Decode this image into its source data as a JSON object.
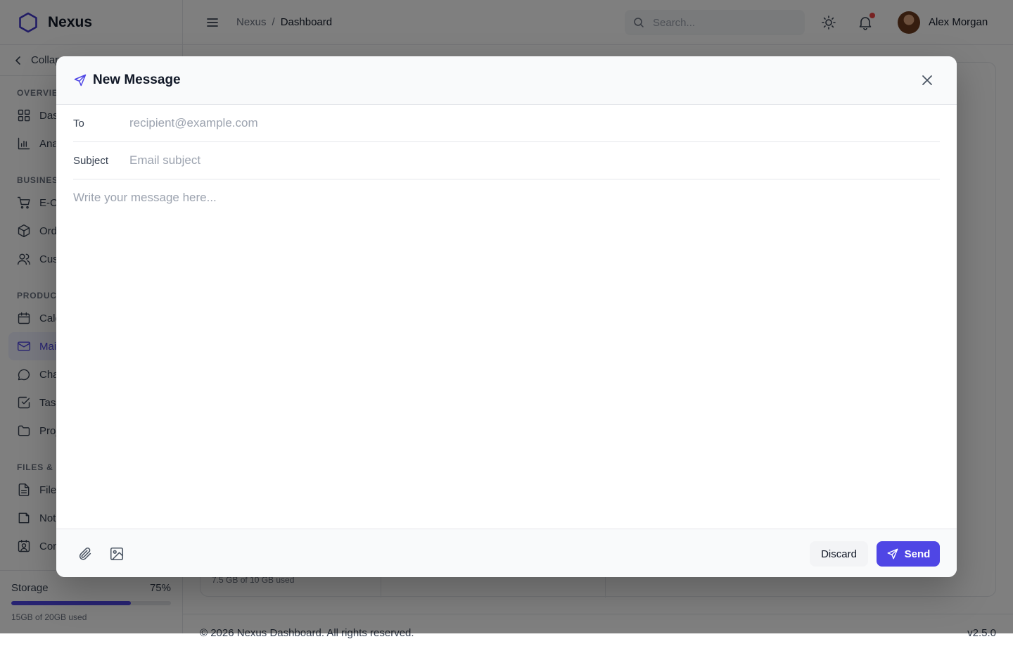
{
  "app": {
    "brand": "Nexus",
    "collapse_label": "Collapse",
    "accent_color": "#4f46e5"
  },
  "sidebar": {
    "sections": [
      {
        "title": "OVERVIEW",
        "items": [
          {
            "label": "Dashboard",
            "icon": "grid-icon"
          },
          {
            "label": "Analytics",
            "icon": "bar-chart-icon"
          }
        ]
      },
      {
        "title": "BUSINESS",
        "items": [
          {
            "label": "E-Commerce",
            "icon": "cart-icon"
          },
          {
            "label": "Orders",
            "icon": "box-icon"
          },
          {
            "label": "Customers",
            "icon": "users-icon"
          }
        ]
      },
      {
        "title": "PRODUCTIVITY",
        "items": [
          {
            "label": "Calendar",
            "icon": "calendar-icon"
          },
          {
            "label": "Mail",
            "icon": "mail-icon",
            "active": true
          },
          {
            "label": "Chat",
            "icon": "chat-icon"
          },
          {
            "label": "Tasks",
            "icon": "checkbox-icon"
          },
          {
            "label": "Projects",
            "icon": "folder-icon"
          }
        ]
      },
      {
        "title": "FILES & NOTES",
        "items": [
          {
            "label": "Files",
            "icon": "file-icon"
          },
          {
            "label": "Notes",
            "icon": "note-icon"
          },
          {
            "label": "Contacts",
            "icon": "contact-icon"
          }
        ]
      }
    ],
    "storage": {
      "label": "Storage",
      "percent_text": "75%",
      "fraction": 0.75,
      "note": "15GB of 20GB used"
    }
  },
  "topbar": {
    "breadcrumb": [
      "Nexus",
      "Dashboard"
    ],
    "search_placeholder": "Search...",
    "user_name": "Alex Morgan"
  },
  "background_content": {
    "card_note": "7.5 GB of 10 GB used"
  },
  "footer": {
    "copyright": "© 2026 Nexus Dashboard. All rights reserved.",
    "version": "v2.5.0"
  },
  "modal": {
    "title": "New Message",
    "to_label": "To",
    "to_placeholder": "recipient@example.com",
    "subject_label": "Subject",
    "subject_placeholder": "Email subject",
    "body_placeholder": "Write your message here...",
    "discard_label": "Discard",
    "send_label": "Send"
  }
}
